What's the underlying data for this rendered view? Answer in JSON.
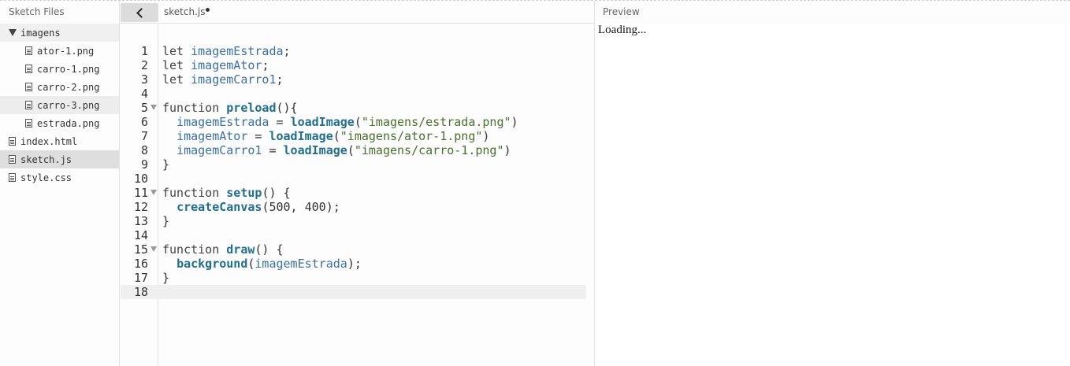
{
  "sidebar": {
    "title": "Sketch Files",
    "folder": {
      "name": "imagens",
      "files": [
        "ator-1.png",
        "carro-1.png",
        "carro-2.png",
        "carro-3.png",
        "estrada.png"
      ]
    },
    "files": [
      "index.html",
      "sketch.js",
      "style.css"
    ]
  },
  "editor": {
    "filename": "sketch.js",
    "line_numbers": [
      "1",
      "2",
      "3",
      "4",
      "5",
      "6",
      "7",
      "8",
      "9",
      "10",
      "11",
      "12",
      "13",
      "14",
      "15",
      "16",
      "17",
      "18"
    ]
  },
  "preview": {
    "title": "Preview",
    "status": "Loading..."
  },
  "colors": {
    "variable": "#3a70a8",
    "function": "#1f6e91",
    "string": "#47702a"
  },
  "icons": {
    "collapse": "chevron-left-icon",
    "folder_open": "triangle-down-icon",
    "file": "file-icon"
  }
}
